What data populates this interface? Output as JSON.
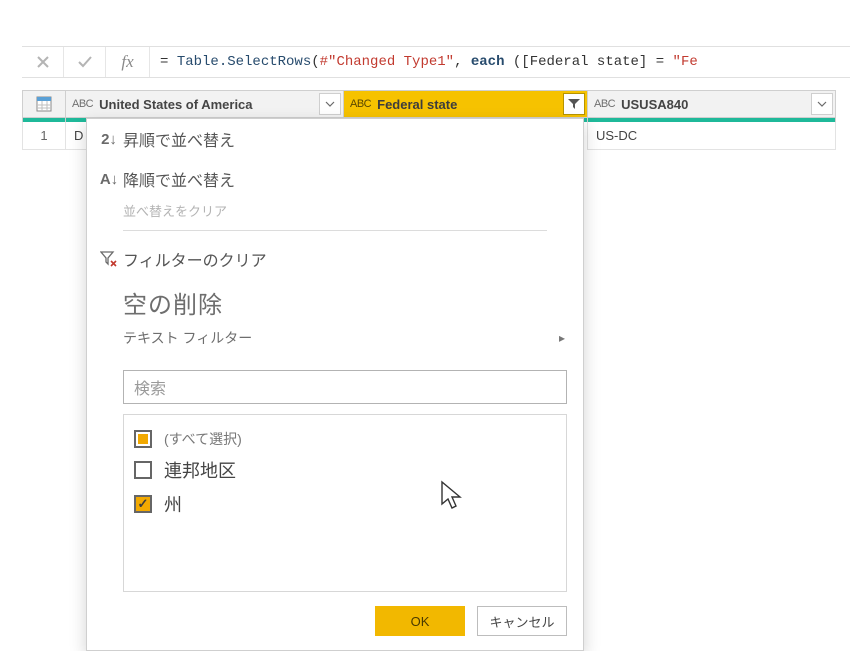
{
  "formula": {
    "eq": "= ",
    "fn": "Table.SelectRows",
    "open": "(",
    "arg1": "#\"Changed Type1\"",
    "comma": ", ",
    "each": "each",
    "sp": " (",
    "field_open": "[",
    "field": "Federal state",
    "field_close": "]",
    "eq2": " = ",
    "val_prefix": "\"Fe"
  },
  "columns": {
    "c1": {
      "type": "ABC",
      "name": "United States of America"
    },
    "c2": {
      "type": "ABC",
      "name": "Federal state"
    },
    "c3": {
      "type": "ABC",
      "name": "USUSA840"
    }
  },
  "row1": {
    "num": "1",
    "c1": "D",
    "c3": "US-DC"
  },
  "menu": {
    "sort_asc_icon": "2↓",
    "sort_asc": "昇順で並べ替え",
    "sort_desc_icon": "A↓",
    "sort_desc": "降順で並べ替え",
    "clear_sort": "並べ替えをクリア",
    "clear_filter": "フィルターのクリア",
    "remove_empty": "空の削除",
    "text_filter": "テキスト フィルター",
    "search_placeholder": "検索"
  },
  "filter_values": {
    "all": "(すべて選択)",
    "v1": "連邦地区",
    "v2": "州"
  },
  "buttons": {
    "ok": "OK",
    "cancel": "キャンセル"
  }
}
